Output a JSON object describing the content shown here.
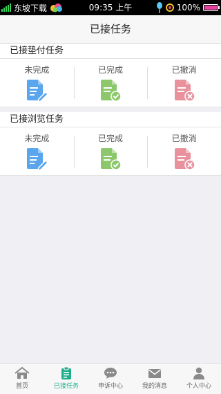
{
  "status": {
    "carrier": "东坡下载",
    "time": "09:35 上午",
    "battery": "100%",
    "battery_level": 1.0
  },
  "header": {
    "title": "已接任务"
  },
  "sections": [
    {
      "title": "已接垫付任务",
      "items": [
        {
          "label": "未完成",
          "icon": "document-edit-icon",
          "color": "#5aa6ee"
        },
        {
          "label": "已完成",
          "icon": "document-check-icon",
          "color": "#8cc86b"
        },
        {
          "label": "已撤消",
          "icon": "document-cancel-icon",
          "color": "#e9929e"
        }
      ]
    },
    {
      "title": "已接浏览任务",
      "items": [
        {
          "label": "未完成",
          "icon": "document-edit-icon",
          "color": "#5aa6ee"
        },
        {
          "label": "已完成",
          "icon": "document-check-icon",
          "color": "#8cc86b"
        },
        {
          "label": "已撤消",
          "icon": "document-cancel-icon",
          "color": "#e9929e"
        }
      ]
    }
  ],
  "tabs": [
    {
      "label": "首页",
      "icon": "home-icon"
    },
    {
      "label": "已接任务",
      "icon": "clipboard-icon",
      "active": true
    },
    {
      "label": "申诉中心",
      "icon": "chat-bubble-icon"
    },
    {
      "label": "我的消息",
      "icon": "envelope-icon"
    },
    {
      "label": "个人中心",
      "icon": "user-icon"
    }
  ],
  "colors": {
    "accent": "#1fae8c",
    "edit": "#5aa6ee",
    "done": "#8cc86b",
    "cancel": "#e9929e"
  }
}
